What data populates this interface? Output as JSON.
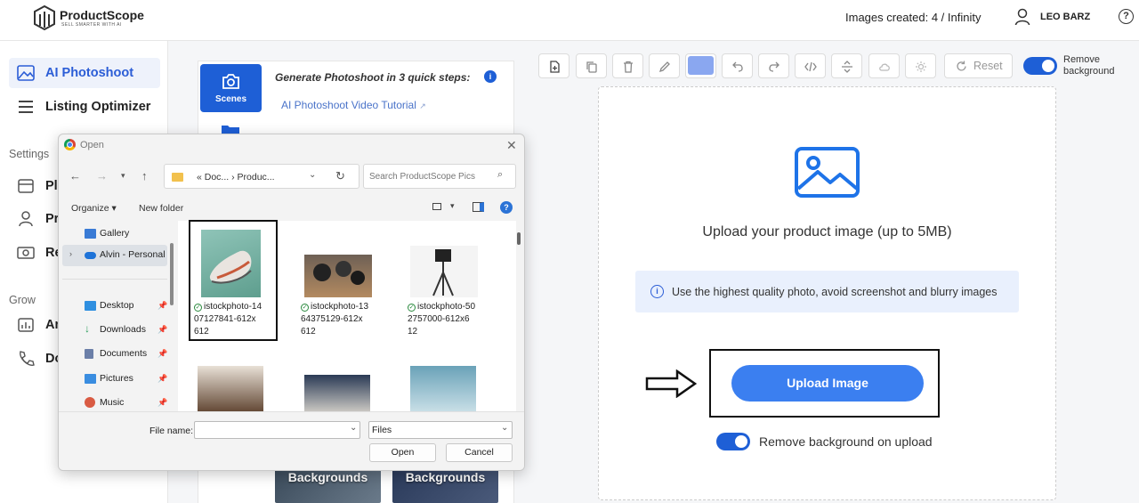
{
  "header": {
    "logo_text": "ProductScope",
    "logo_tagline": "SELL SMARTER WITH AI",
    "images_created": "Images created: 4 / Infinity",
    "user_name": "LEO BARZ",
    "help_label": "?"
  },
  "sidebar": {
    "items": [
      {
        "label": "AI Photoshoot",
        "icon": "image-icon"
      },
      {
        "label": "Listing Optimizer",
        "icon": "list-icon"
      }
    ],
    "settings_label": "Settings",
    "settings_items": [
      {
        "label": "Pl",
        "icon": "box-icon"
      },
      {
        "label": "Pr",
        "icon": "person-icon"
      },
      {
        "label": "Re",
        "icon": "money-icon"
      }
    ],
    "grow_label": "Grow",
    "grow_items": [
      {
        "label": "An",
        "icon": "chart-icon"
      },
      {
        "label": "Do",
        "icon": "phone-icon"
      }
    ]
  },
  "middle": {
    "scenes_label": "Scenes",
    "title": "Generate Photoshoot in 3 quick steps:",
    "tutorial_link": "AI Photoshoot Video Tutorial",
    "bg_cards": [
      "Backgrounds",
      "Backgrounds"
    ]
  },
  "toolbar": {
    "reset_label": "Reset",
    "remove_bg_label_1": "Remove",
    "remove_bg_label_2": "background",
    "swatch_color": "#8aa7f0"
  },
  "upload": {
    "title": "Upload your product image (up to 5MB)",
    "hint": "Use the highest quality photo, avoid screenshot and blurry images",
    "button_label": "Upload Image",
    "remove_bg_on_upload": "Remove background on upload"
  },
  "dialog": {
    "title": "Open",
    "path_text": "« Doc...  ›  Produc...",
    "search_placeholder": "Search ProductScope Pics",
    "organize_label": "Organize ▾",
    "new_folder_label": "New folder",
    "nav_items": [
      {
        "label": "Gallery",
        "color": "#3a7bd5"
      },
      {
        "label": "Alvin - Personal",
        "color": "#1e73d8"
      },
      {
        "label": "Desktop",
        "color": "#2f8fe0"
      },
      {
        "label": "Downloads",
        "color": "#2a9d5a"
      },
      {
        "label": "Documents",
        "color": "#6b7fa8"
      },
      {
        "label": "Pictures",
        "color": "#3a8de0"
      },
      {
        "label": "Music",
        "color": "#d95b43"
      }
    ],
    "files": [
      {
        "line1": "istockphoto-14",
        "line2": "07127841-612x",
        "line3": "612"
      },
      {
        "line1": "istockphoto-13",
        "line2": "64375129-612x",
        "line3": "612"
      },
      {
        "line1": "istockphoto-50",
        "line2": "2757000-612x6",
        "line3": "12"
      }
    ],
    "file_name_label": "File name:",
    "file_type": "Files",
    "open_label": "Open",
    "cancel_label": "Cancel"
  }
}
